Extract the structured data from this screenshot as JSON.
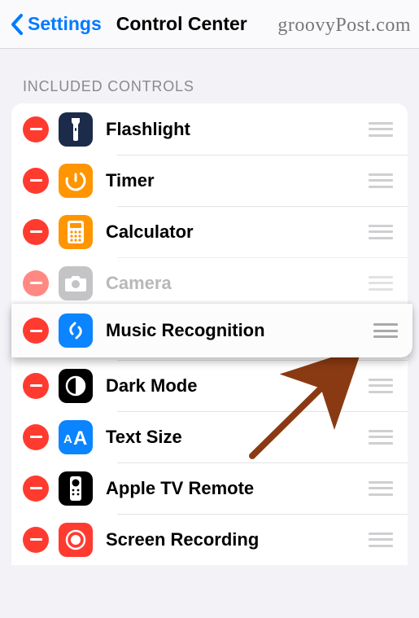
{
  "nav": {
    "back": "Settings",
    "title": "Control Center"
  },
  "watermark": "groovyPost.com",
  "section_header": "INCLUDED CONTROLS",
  "controls": [
    {
      "label": "Flashlight",
      "icon": "flashlight-icon"
    },
    {
      "label": "Timer",
      "icon": "timer-icon"
    },
    {
      "label": "Calculator",
      "icon": "calculator-icon"
    },
    {
      "label": "Camera",
      "icon": "camera-icon"
    },
    {
      "label": "Music Recognition",
      "icon": "shazam-icon"
    },
    {
      "label": "Dark Mode",
      "icon": "dark-mode-icon"
    },
    {
      "label": "Text Size",
      "icon": "text-size-icon"
    },
    {
      "label": "Apple TV Remote",
      "icon": "apple-tv-remote-icon"
    },
    {
      "label": "Screen Recording",
      "icon": "screen-recording-icon"
    }
  ]
}
